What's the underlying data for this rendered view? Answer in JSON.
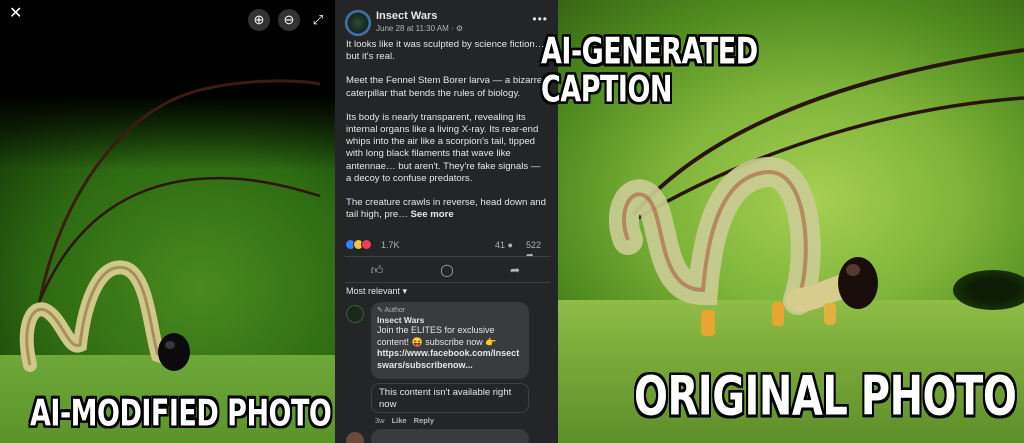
{
  "viewer": {
    "close_icon": "close-icon",
    "zoom_in_icon": "zoom-in-icon",
    "zoom_out_icon": "zoom-out-icon",
    "fullscreen_icon": "fullscreen-icon"
  },
  "overlays": {
    "left_caption": "AI-MODIFIED PHOTO",
    "middle_caption": "AI-GENERATED\nCAPTION",
    "right_caption": "ORIGINAL PHOTO"
  },
  "post": {
    "page_name": "Insect Wars",
    "date": "June 28 at 11:30 AM · ",
    "paragraphs": [
      "It looks like it was sculpted by science fiction… but it's real.",
      "Meet the Fennel Stem Borer larva — a bizarre caterpillar that bends the rules of biology.",
      "Its body is nearly transparent, revealing its internal organs like a living X-ray. Its rear-end whips into the air like a scorpion's tail, tipped with long black filaments that wave like antennae… but aren't. They're fake signals — a decoy to confuse predators.",
      "The creature crawls in reverse, head down and tail high, pre… "
    ],
    "see_more": "See more",
    "reactions_count": "1.7K",
    "comments_count": "41",
    "shares_count": "522",
    "sort_label": "Most relevant"
  },
  "comment": {
    "author_tag": "Author",
    "name": "Insect Wars",
    "text": "Join the ELITES for exclusive content! 😝 subscribe now 👉",
    "link": "https://www.facebook.com/Insectswars/subscribenow...",
    "unavailable": "This content isn't available right now",
    "time": "3w",
    "like": "Like",
    "reply": "Reply"
  },
  "colors": {
    "fb_bg": "#242526",
    "fb_text": "#e4e6eb",
    "fb_muted": "#b0b3b8"
  }
}
